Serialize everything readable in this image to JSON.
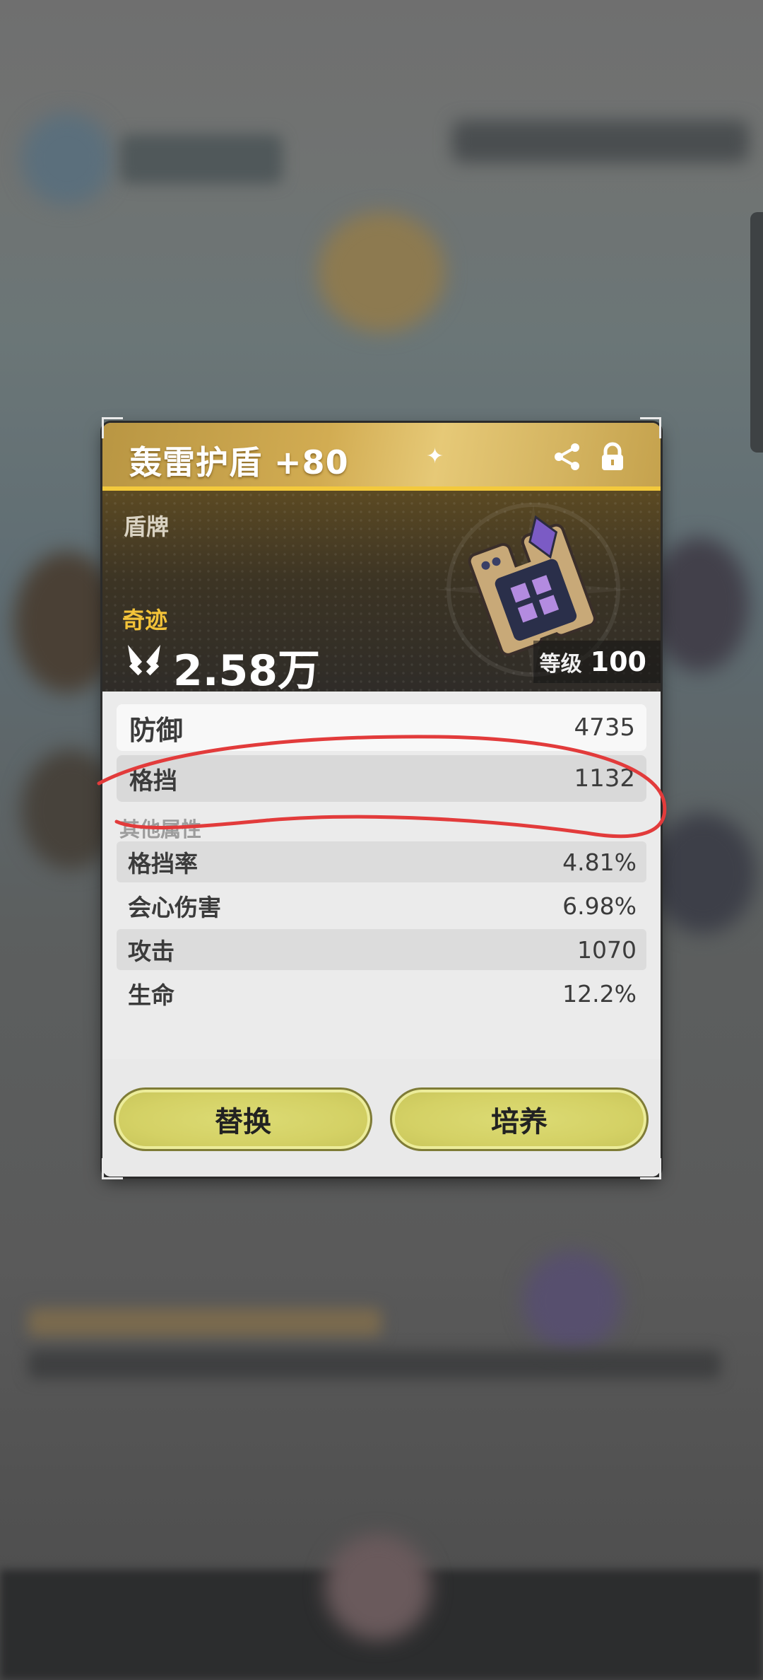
{
  "item": {
    "title": "轰雷护盾 +80",
    "category": "盾牌",
    "rarity": "奇迹",
    "power": "2.58万",
    "level_label": "等级",
    "level_value": "100"
  },
  "main_stats": [
    {
      "name": "防御",
      "value": "4735"
    },
    {
      "name": "格挡",
      "value": "1132"
    }
  ],
  "other_title": "其他属性",
  "sub_stats": [
    {
      "name": "格挡率",
      "value": "4.81%"
    },
    {
      "name": "会心伤害",
      "value": "6.98%"
    },
    {
      "name": "攻击",
      "value": "1070"
    },
    {
      "name": "生命",
      "value": "12.2%"
    }
  ],
  "buttons": {
    "replace": "替换",
    "cultivate": "培养"
  },
  "icons": {
    "share": "share-icon",
    "lock": "lock-icon",
    "power": "crossed-weapons-icon",
    "shield": "shield-equipment-art"
  },
  "colors": {
    "header_gold": "#d2ac52",
    "rarity_gold": "#f3c339",
    "button_yellow": "#d4d165",
    "annotation_red": "#e23b3b"
  }
}
